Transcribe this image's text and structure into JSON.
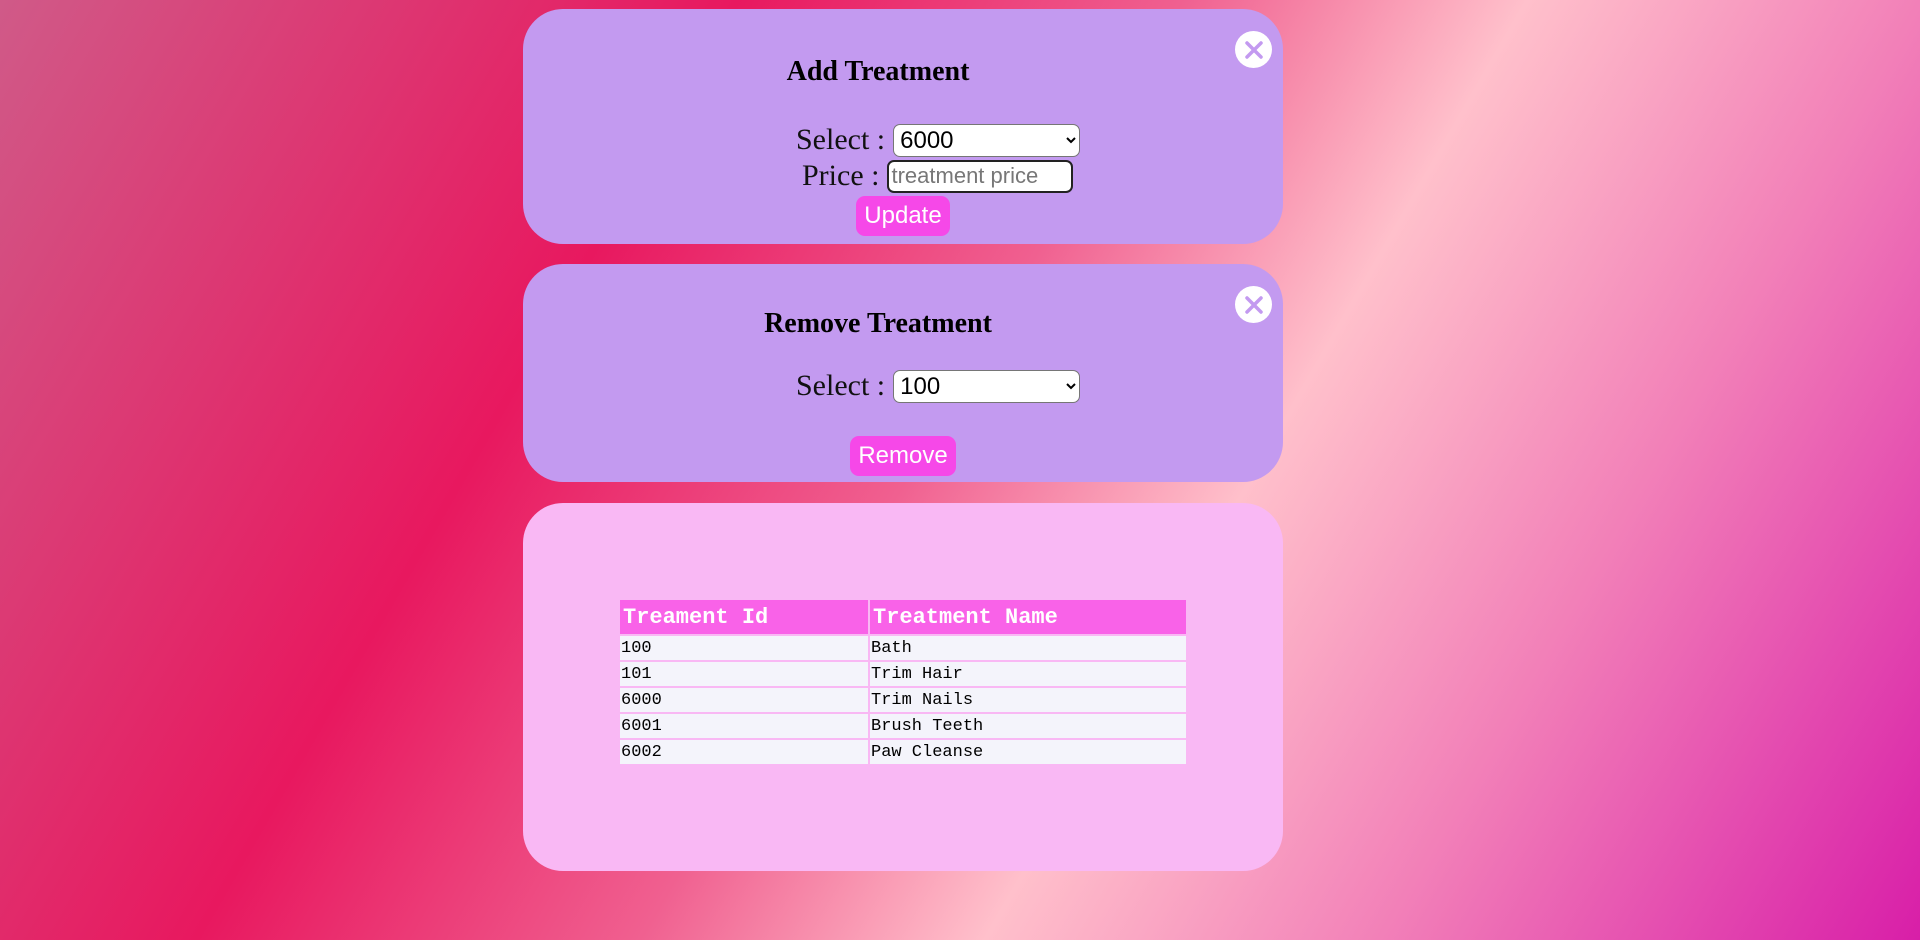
{
  "add_treatment": {
    "title": "Add Treatment",
    "select_label": "Select :",
    "selected_value": "6000",
    "price_label": "Price :",
    "price_placeholder": "treatment price",
    "price_value": "",
    "button_label": "Update"
  },
  "remove_treatment": {
    "title": "Remove Treatment",
    "select_label": "Select :",
    "selected_value": "100",
    "button_label": "Remove"
  },
  "table": {
    "headers": [
      "Treament Id",
      "Treatment Name"
    ],
    "rows": [
      [
        "100",
        "Bath"
      ],
      [
        "101",
        "Trim Hair"
      ],
      [
        "6000",
        "Trim Nails"
      ],
      [
        "6001",
        "Brush Teeth"
      ],
      [
        "6002",
        "Paw Cleanse"
      ]
    ]
  },
  "icons": {
    "close": "close-icon"
  },
  "colors": {
    "card_purple": "#c39af0",
    "card_pink": "#f9b8f4",
    "button": "#f648e8",
    "table_header": "#f962e8",
    "close_icon": "#c39af0"
  }
}
